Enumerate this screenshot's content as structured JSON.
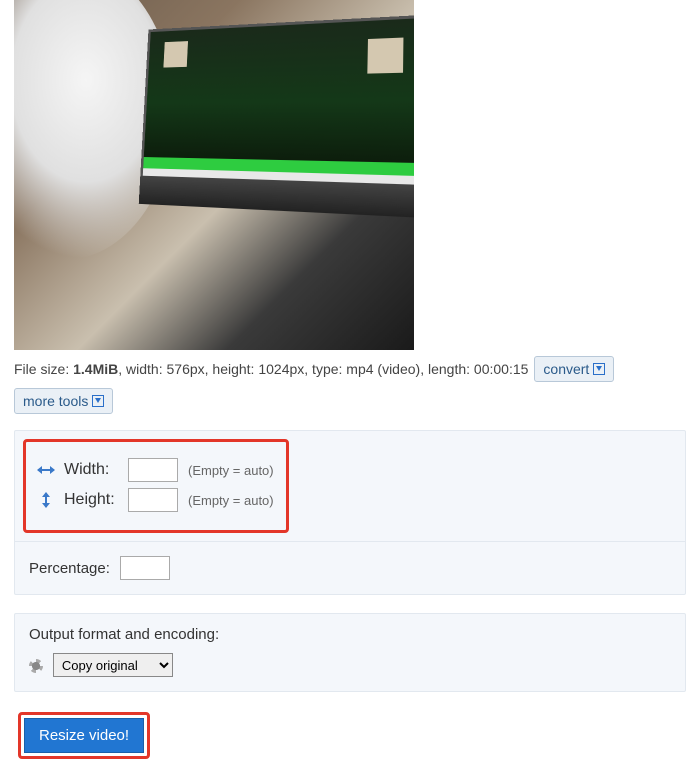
{
  "file_info": {
    "prefix": "File size: ",
    "size": "1.4MiB",
    "rest": ", width: 576px, height: 1024px, type: mp4 (video), length: 00:00:15"
  },
  "toolbar": {
    "convert_label": "convert",
    "more_tools_label": "more tools"
  },
  "dimensions": {
    "width_label": "Width:",
    "height_label": "Height:",
    "width_value": "",
    "height_value": "",
    "hint": "(Empty = auto)"
  },
  "percentage": {
    "label": "Percentage:",
    "value": ""
  },
  "output": {
    "title": "Output format and encoding:",
    "selected": "Copy original",
    "options": [
      "Copy original"
    ]
  },
  "submit": {
    "label": "Resize video!"
  }
}
